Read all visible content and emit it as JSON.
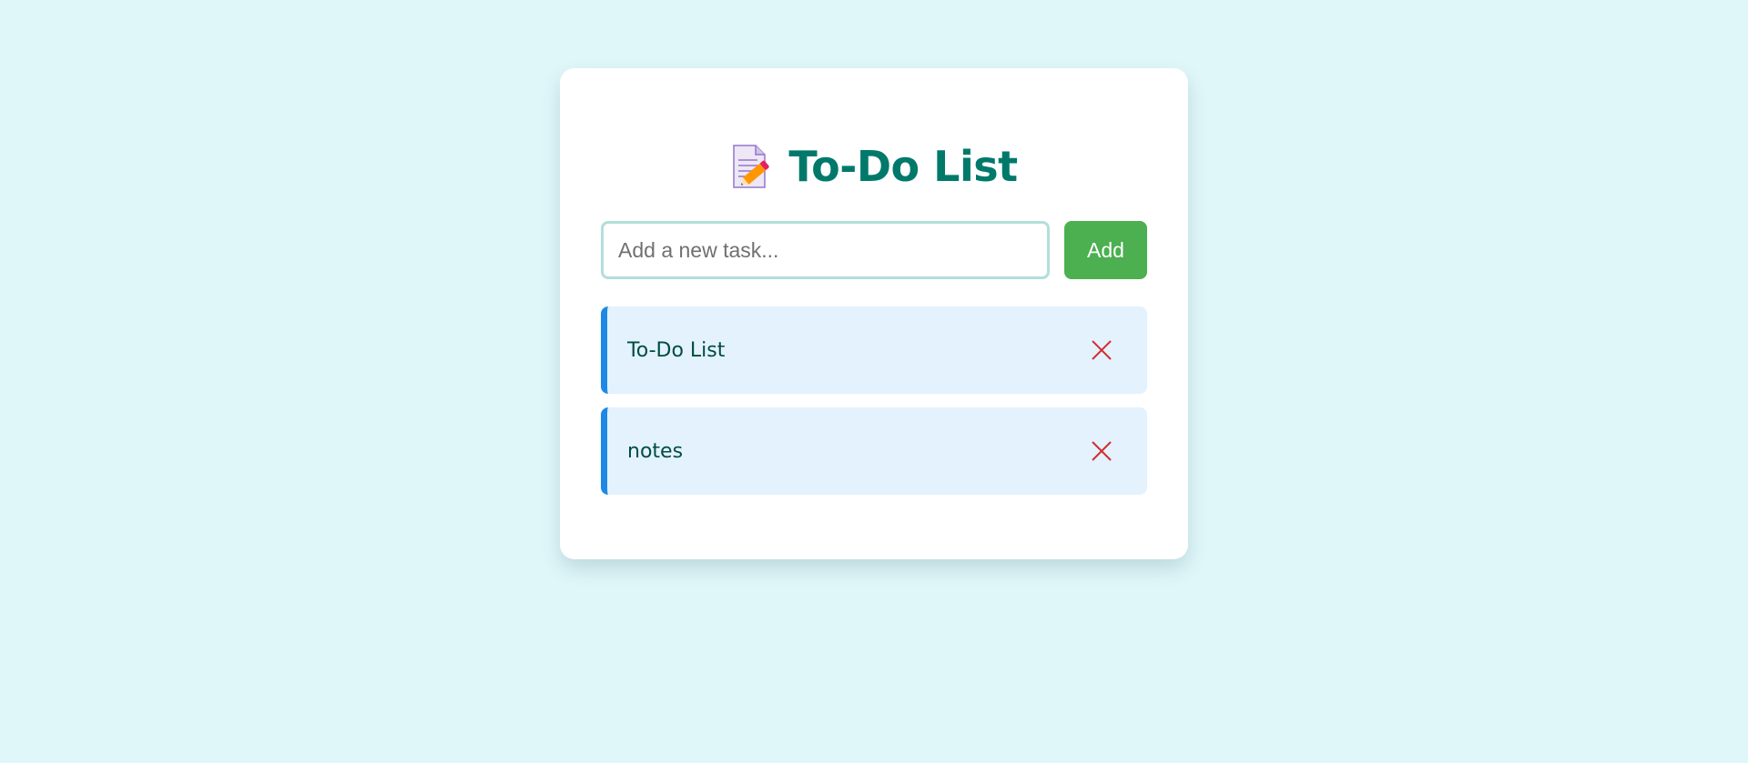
{
  "app": {
    "title": "To-Do List",
    "icon": "memo-icon"
  },
  "input": {
    "placeholder": "Add a new task...",
    "value": ""
  },
  "add_button": {
    "label": "Add"
  },
  "tasks": [
    {
      "text": "To-Do List",
      "delete_icon": "close-icon"
    },
    {
      "text": "notes",
      "delete_icon": "close-icon"
    }
  ],
  "colors": {
    "background": "#e0f7fa",
    "title": "#00796b",
    "add_button": "#4caf50",
    "task_background": "#e3f2fd",
    "task_accent": "#1e88e5",
    "delete": "#d32f2f"
  }
}
